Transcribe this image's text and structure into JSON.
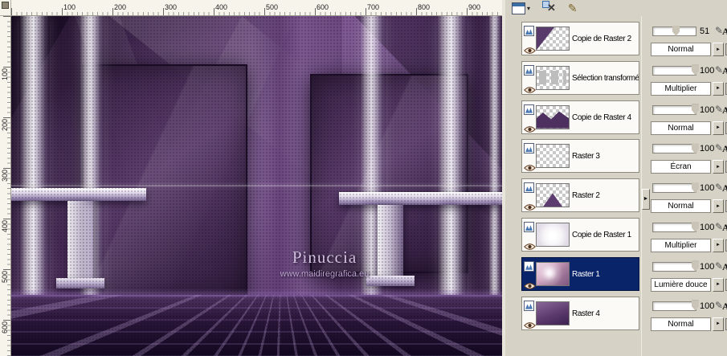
{
  "colors": {
    "panel_bg": "#d6d2c6",
    "selection_blue": "#0a246a",
    "accent_blue": "#3a6ea5",
    "canvas_deep_purple": "#2b1836"
  },
  "rulers": {
    "horizontal_labels": [
      "100",
      "200",
      "300",
      "400",
      "500",
      "600",
      "700",
      "800",
      "900"
    ],
    "vertical_labels": [
      "100",
      "200",
      "300",
      "400",
      "500",
      "600"
    ]
  },
  "toolbar": {
    "icons": [
      {
        "name": "layer-palette-icon",
        "glyph": "▾"
      },
      {
        "name": "delete-layer-icon",
        "glyph": "✕"
      },
      {
        "name": "edit-layer-icon",
        "glyph": "✎"
      }
    ]
  },
  "artwork": {
    "signature": "Pinuccia",
    "website": "www.maidiregrafica.eu"
  },
  "layers_panel": {
    "collapse_arrow": "►",
    "layers": [
      {
        "name": "Copie de Raster 2",
        "thumb": "purple-triangle-left",
        "visible": true,
        "selected": false
      },
      {
        "name": "Sélection transformée",
        "thumb": "gray-blocks",
        "visible": true,
        "selected": false
      },
      {
        "name": "Copie de Raster 4",
        "thumb": "purple-wave-bottom",
        "visible": true,
        "selected": false
      },
      {
        "name": "Raster 3",
        "thumb": "plain",
        "visible": true,
        "selected": false
      },
      {
        "name": "Raster 2",
        "thumb": "purple-triangle-bottom",
        "visible": true,
        "selected": false
      },
      {
        "name": "Copie de Raster 1",
        "thumb": "white-glow",
        "visible": true,
        "selected": false
      },
      {
        "name": "Raster 1",
        "thumb": "pink-image",
        "visible": true,
        "selected": true
      },
      {
        "name": "Raster 4",
        "thumb": "solid-purple",
        "visible": true,
        "selected": false
      }
    ]
  },
  "properties_panel": {
    "dropdown_arrow": "►",
    "brush_glyph": "✎",
    "lock_label": "A",
    "entries": [
      {
        "opacity": "51",
        "blend_mode": "Normal"
      },
      {
        "opacity": "100",
        "blend_mode": "Multiplier"
      },
      {
        "opacity": "100",
        "blend_mode": "Normal"
      },
      {
        "opacity": "100",
        "blend_mode": "Écran"
      },
      {
        "opacity": "100",
        "blend_mode": "Normal"
      },
      {
        "opacity": "100",
        "blend_mode": "Multiplier"
      },
      {
        "opacity": "100",
        "blend_mode": "Lumière douce"
      },
      {
        "opacity": "100",
        "blend_mode": "Normal"
      }
    ]
  }
}
